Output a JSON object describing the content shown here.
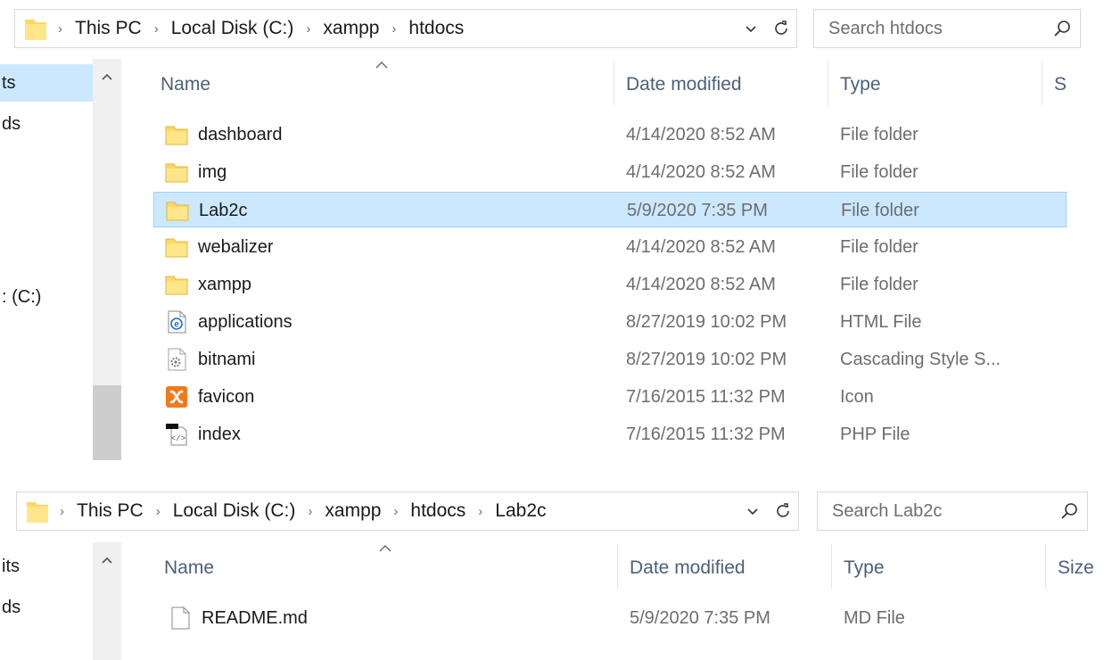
{
  "panels": [
    {
      "breadcrumb": [
        "This PC",
        "Local Disk (C:)",
        "xampp",
        "htdocs"
      ],
      "search_placeholder": "Search htdocs",
      "nav_items": [
        "ts",
        "ds",
        ": (C:)"
      ],
      "columns": {
        "name": "Name",
        "date": "Date modified",
        "type": "Type",
        "size": "S"
      },
      "rows": [
        {
          "name": "dashboard",
          "date": "4/14/2020 8:52 AM",
          "type": "File folder",
          "icon": "folder-icon"
        },
        {
          "name": "img",
          "date": "4/14/2020 8:52 AM",
          "type": "File folder",
          "icon": "folder-icon"
        },
        {
          "name": "Lab2c",
          "date": "5/9/2020 7:35 PM",
          "type": "File folder",
          "icon": "folder-icon",
          "selected": true
        },
        {
          "name": "webalizer",
          "date": "4/14/2020 8:52 AM",
          "type": "File folder",
          "icon": "folder-icon"
        },
        {
          "name": "xampp",
          "date": "4/14/2020 8:52 AM",
          "type": "File folder",
          "icon": "folder-icon"
        },
        {
          "name": "applications",
          "date": "8/27/2019 10:02 PM",
          "type": "HTML File",
          "icon": "html-file-icon"
        },
        {
          "name": "bitnami",
          "date": "8/27/2019 10:02 PM",
          "type": "Cascading Style S...",
          "icon": "css-file-icon"
        },
        {
          "name": "favicon",
          "date": "7/16/2015 11:32 PM",
          "type": "Icon",
          "icon": "xampp-icon-file-icon"
        },
        {
          "name": "index",
          "date": "7/16/2015 11:32 PM",
          "type": "PHP File",
          "icon": "php-file-icon"
        }
      ]
    },
    {
      "breadcrumb": [
        "This PC",
        "Local Disk (C:)",
        "xampp",
        "htdocs",
        "Lab2c"
      ],
      "search_placeholder": "Search Lab2c",
      "nav_items": [
        "its",
        "ds"
      ],
      "columns": {
        "name": "Name",
        "date": "Date modified",
        "type": "Type",
        "size": "Size"
      },
      "rows": [
        {
          "name": "README.md",
          "date": "5/9/2020 7:35 PM",
          "type": "MD File",
          "icon": "text-file-icon"
        }
      ]
    }
  ],
  "colors": {
    "selection": "#cce8ff",
    "selection_border": "#99d1ff",
    "folder": "#ffd766",
    "header_text": "#4c607a",
    "secondary_text": "#6d6d6d"
  }
}
